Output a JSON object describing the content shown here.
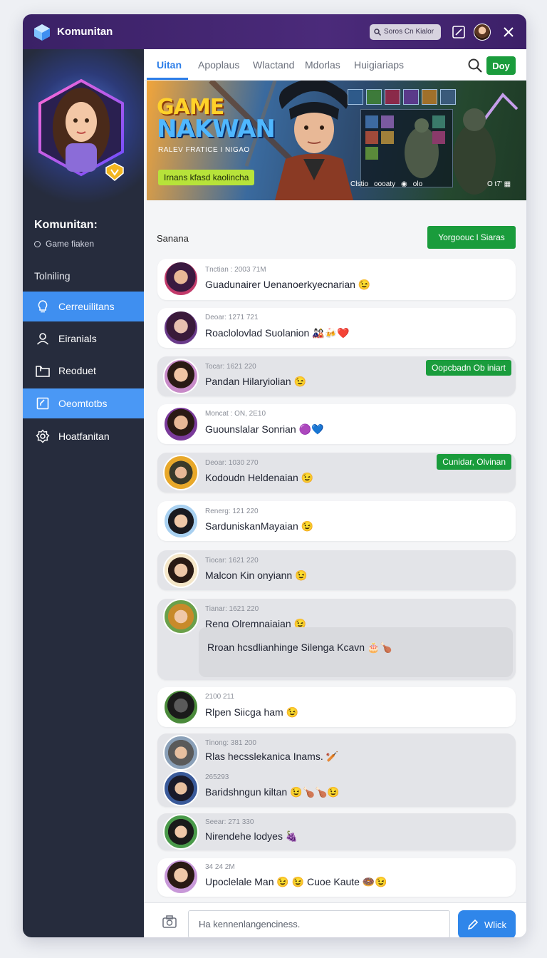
{
  "app": {
    "title": "Komunitan",
    "search_placeholder": "Soros Cn Kialor"
  },
  "sidebar": {
    "profile_name": "Komunitan:",
    "profile_sub": "Game fiaken",
    "section_label": "Tolniling",
    "items": [
      {
        "label": "Cerreuilitans",
        "icon": "lightbulb-icon"
      },
      {
        "label": "Eiranials",
        "icon": "user-icon"
      },
      {
        "label": "Reoduet",
        "icon": "folder-icon"
      },
      {
        "label": "Oeomtotbs",
        "icon": "edit-icon"
      },
      {
        "label": "Hoatfanitan",
        "icon": "settings-icon"
      }
    ]
  },
  "tabs": [
    "Uitan",
    "Apoplaus",
    "Wlactand",
    "Mdorlas",
    "Huigiariaps"
  ],
  "header": {
    "go_button": "Doy"
  },
  "banner": {
    "title_line1": "GAME",
    "title_line2": "NAKWAN",
    "subtitle": "RALEV FRATICE I NIGAO",
    "cta": "Irnans kfasd kaolincha",
    "status_left": "Clstio",
    "status_mid": "oooaty",
    "status_right": "olo",
    "status_far": "O t7'"
  },
  "feed": {
    "sort_label": "Sanana",
    "sort_button": "Yorgoouc l Siaras",
    "messages": [
      {
        "meta": "Tnctian : 2003 71M",
        "text": "Guadunairer Uenanoerkyecnarian 😉",
        "style": "white"
      },
      {
        "meta": "Deoar: 1271 721",
        "text": "Roaclolovlad Suolanion 🎎🍻❤️",
        "style": "white"
      },
      {
        "meta": "Tocar: 1621 220",
        "text": "Pandan Hilaryiolian 😉",
        "style": "gray",
        "badge": "Oopcbadn Ob iniart"
      },
      {
        "meta": "Moncat : ON, 2E10",
        "text": "Guounslalar Sonrian 🟣💙",
        "style": "white"
      },
      {
        "meta": "Deoar: 1030 270",
        "text": "Kodoudn Heldenaian 😉",
        "style": "gray",
        "badge": "Cunidar, Olvinan"
      },
      {
        "meta": "Renerg: 121 220",
        "text": "SarduniskanMayaian 😉",
        "style": "white"
      },
      {
        "meta": "Tiocar: 1621 220",
        "text": "Malcon Kin onyiann 😉",
        "style": "gray"
      },
      {
        "meta": "Tianar: 1621 220",
        "text": "Reng Olremnaiaian 😉",
        "style": "gray",
        "reply": "Rroan hcsdlianhinge Silenga Kcavn 🎂🍗"
      },
      {
        "meta": "2100 211",
        "text": "Rlpen Siicga ham 😉",
        "style": "white"
      },
      {
        "meta": "Tinong: 381 200",
        "text": "Rlas hecsslekanica Inams. 🏏",
        "style": "gray",
        "meta2": "265293",
        "text2": "Baridshngun kiltan 😉🍗🍗😉"
      },
      {
        "meta": "Seear: 271 330",
        "text": "Nirendehe lodyes 🍇",
        "style": "gray"
      },
      {
        "meta": "34 24 2M",
        "text": "Upoclelale Man 😉 😉 Cuoe Kaute 🍩😉",
        "style": "white"
      }
    ]
  },
  "composer": {
    "placeholder": "Ha kennenlangenciness.",
    "send_label": "Wlick"
  },
  "colors": {
    "titlebar": "#3a2166",
    "sidebar": "#262c3d",
    "accent_blue": "#3f8ff0",
    "accent_green": "#1a9c3c"
  }
}
